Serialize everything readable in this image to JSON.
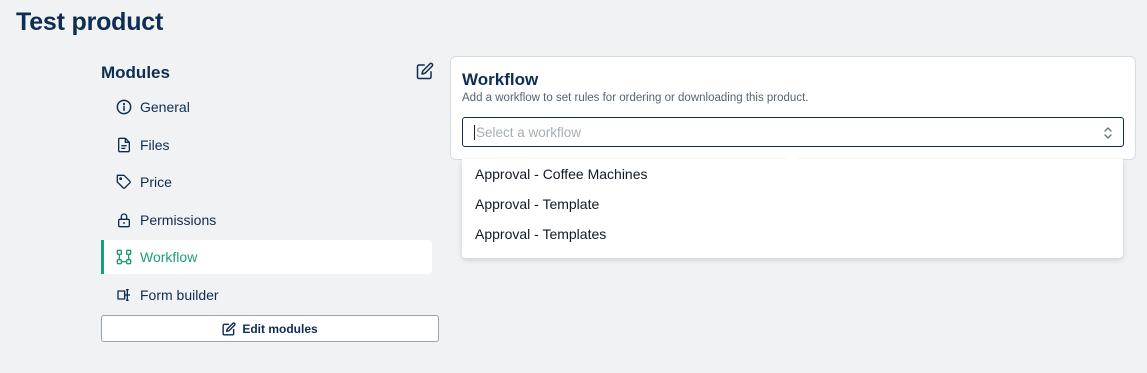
{
  "page": {
    "title": "Test product"
  },
  "modules": {
    "title": "Modules",
    "edit_icon": "pencil-square-icon",
    "items": [
      {
        "label": "General",
        "icon": "info-circle-icon",
        "active": false
      },
      {
        "label": "Files",
        "icon": "file-icon",
        "active": false
      },
      {
        "label": "Price",
        "icon": "tag-icon",
        "active": false
      },
      {
        "label": "Permissions",
        "icon": "lock-icon",
        "active": false
      },
      {
        "label": "Workflow",
        "icon": "workflow-icon",
        "active": true
      },
      {
        "label": "Form builder",
        "icon": "form-builder-icon",
        "active": false
      }
    ],
    "edit_button_label": "Edit modules",
    "active_color": "#1d9d7c"
  },
  "workflow": {
    "title": "Workflow",
    "subtitle": "Add a workflow to set rules for ordering or downloading this product.",
    "select": {
      "placeholder": "Select a workflow",
      "value": ""
    },
    "options": [
      "Approval - Coffee Machines",
      "Approval - Template",
      "Approval - Templates"
    ]
  },
  "colors": {
    "primary": "#0d2d52",
    "background": "#f1f2f4",
    "accent": "#1d9d7c"
  }
}
